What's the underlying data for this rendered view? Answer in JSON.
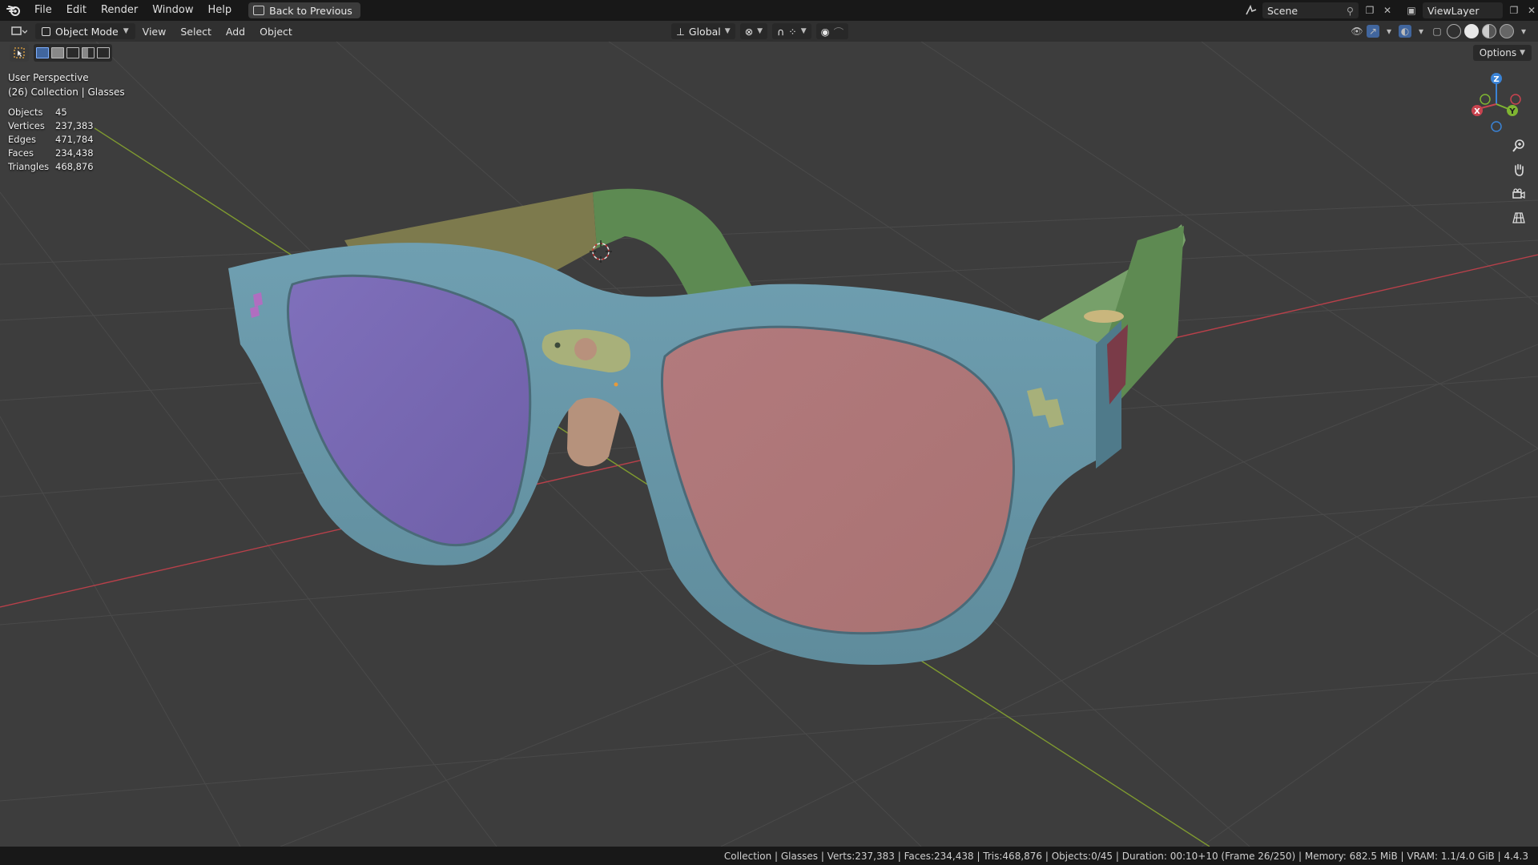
{
  "topbar": {
    "menus": [
      "File",
      "Edit",
      "Render",
      "Window",
      "Help"
    ],
    "back_label": "Back to Previous",
    "scene_name": "Scene",
    "view_layer": "ViewLayer"
  },
  "header": {
    "mode": "Object Mode",
    "menus": [
      "View",
      "Select",
      "Add",
      "Object"
    ],
    "orientation": "Global",
    "options_label": "Options"
  },
  "viewport": {
    "perspective": "User Perspective",
    "collection_line": "(26) Collection | Glasses",
    "stats": [
      {
        "label": "Objects",
        "value": "45"
      },
      {
        "label": "Vertices",
        "value": "237,383"
      },
      {
        "label": "Edges",
        "value": "471,784"
      },
      {
        "label": "Faces",
        "value": "234,438"
      },
      {
        "label": "Triangles",
        "value": "468,876"
      }
    ],
    "gizmo": {
      "x": "X",
      "y": "Y",
      "z": "Z"
    }
  },
  "statusbar": {
    "text": "Collection | Glasses | Verts:237,383 | Faces:234,438 | Tris:468,876 | Objects:0/45 | Duration: 00:10+10 (Frame 26/250) | Memory: 682.5 MiB | VRAM: 1.1/4.0 GiB | 4.4.3"
  },
  "colors": {
    "frame": "#6a97a8",
    "lens_left": "#8071b4",
    "lens_right": "#b87c7c",
    "temple": "#6f9a5e",
    "x_axis": "#c9434f",
    "y_axis": "#7fb532",
    "z_axis": "#3a83d6"
  }
}
